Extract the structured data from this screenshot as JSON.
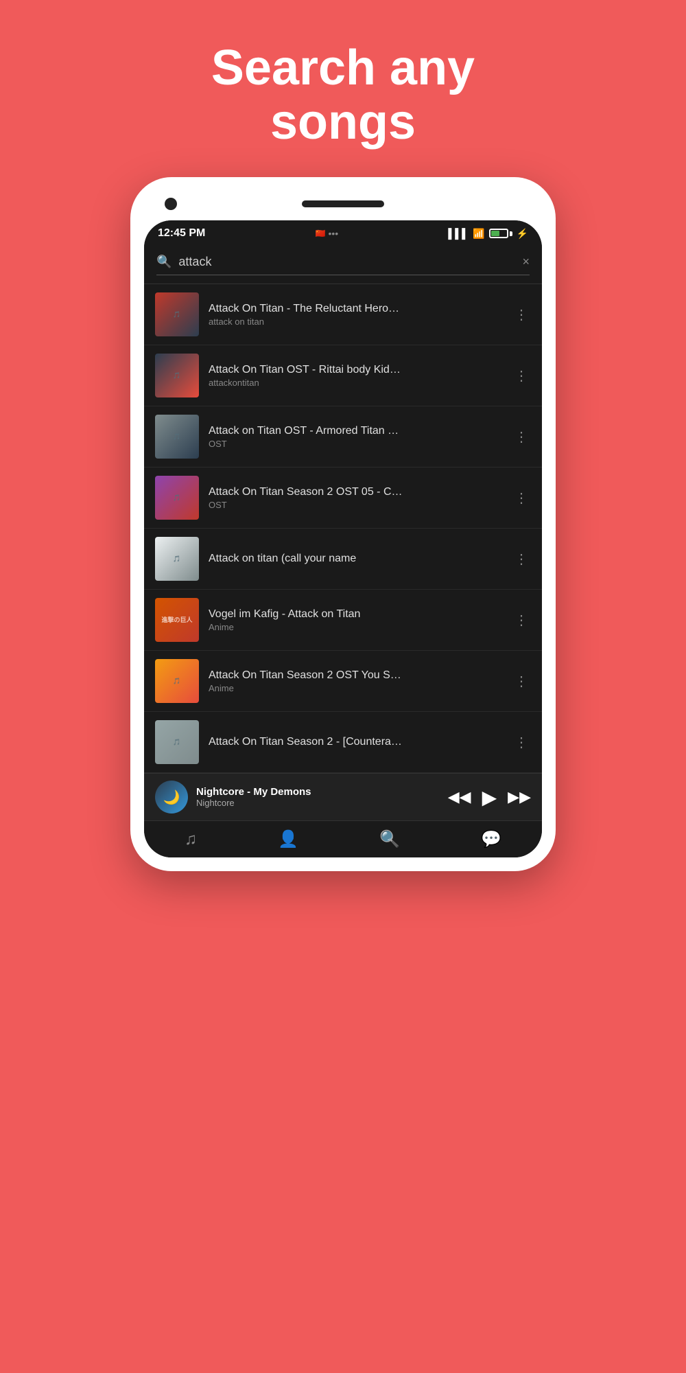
{
  "header": {
    "title_line1": "Search any",
    "title_line2": "songs"
  },
  "status_bar": {
    "time": "12:45 PM",
    "signal_icon": "▌▌▌▌",
    "wifi_icon": "wifi",
    "battery_level": "41",
    "charge_icon": "⚡"
  },
  "search": {
    "query": "attack",
    "placeholder": "attack",
    "clear_label": "×"
  },
  "songs": [
    {
      "id": 1,
      "title": "Attack On Titan - The Reluctant Hero…",
      "subtitle": "attack on titan",
      "thumb_class": "thumb-1",
      "thumb_text": "🎵"
    },
    {
      "id": 2,
      "title": "Attack On Titan OST - Rittai body Kid…",
      "subtitle": "attackontitan",
      "thumb_class": "thumb-2",
      "thumb_text": "🎵"
    },
    {
      "id": 3,
      "title": "Attack on Titan OST - Armored Titan …",
      "subtitle": "OST",
      "thumb_class": "thumb-3",
      "thumb_text": "🎵"
    },
    {
      "id": 4,
      "title": "Attack On Titan Season 2 OST 05 - C…",
      "subtitle": "OST",
      "thumb_class": "thumb-4",
      "thumb_text": "🎵"
    },
    {
      "id": 5,
      "title": "Attack on titan (call your name",
      "subtitle": "",
      "thumb_class": "thumb-5",
      "thumb_text": "🎵"
    },
    {
      "id": 6,
      "title": "Vogel im Kafig - Attack on Titan",
      "subtitle": "Anime",
      "thumb_class": "thumb-6",
      "thumb_text": "進撃の巨人"
    },
    {
      "id": 7,
      "title": "Attack On Titan Season 2 OST  You S…",
      "subtitle": "Anime",
      "thumb_class": "thumb-7",
      "thumb_text": "🎵"
    },
    {
      "id": 8,
      "title": "Attack On Titan Season 2 - [Countera…",
      "subtitle": "",
      "thumb_class": "thumb-8",
      "thumb_text": "🎵"
    }
  ],
  "now_playing": {
    "title": "Nightcore - My Demons",
    "artist": "Nightcore"
  },
  "bottom_nav": {
    "items": [
      "music",
      "profile",
      "search",
      "chat"
    ]
  }
}
